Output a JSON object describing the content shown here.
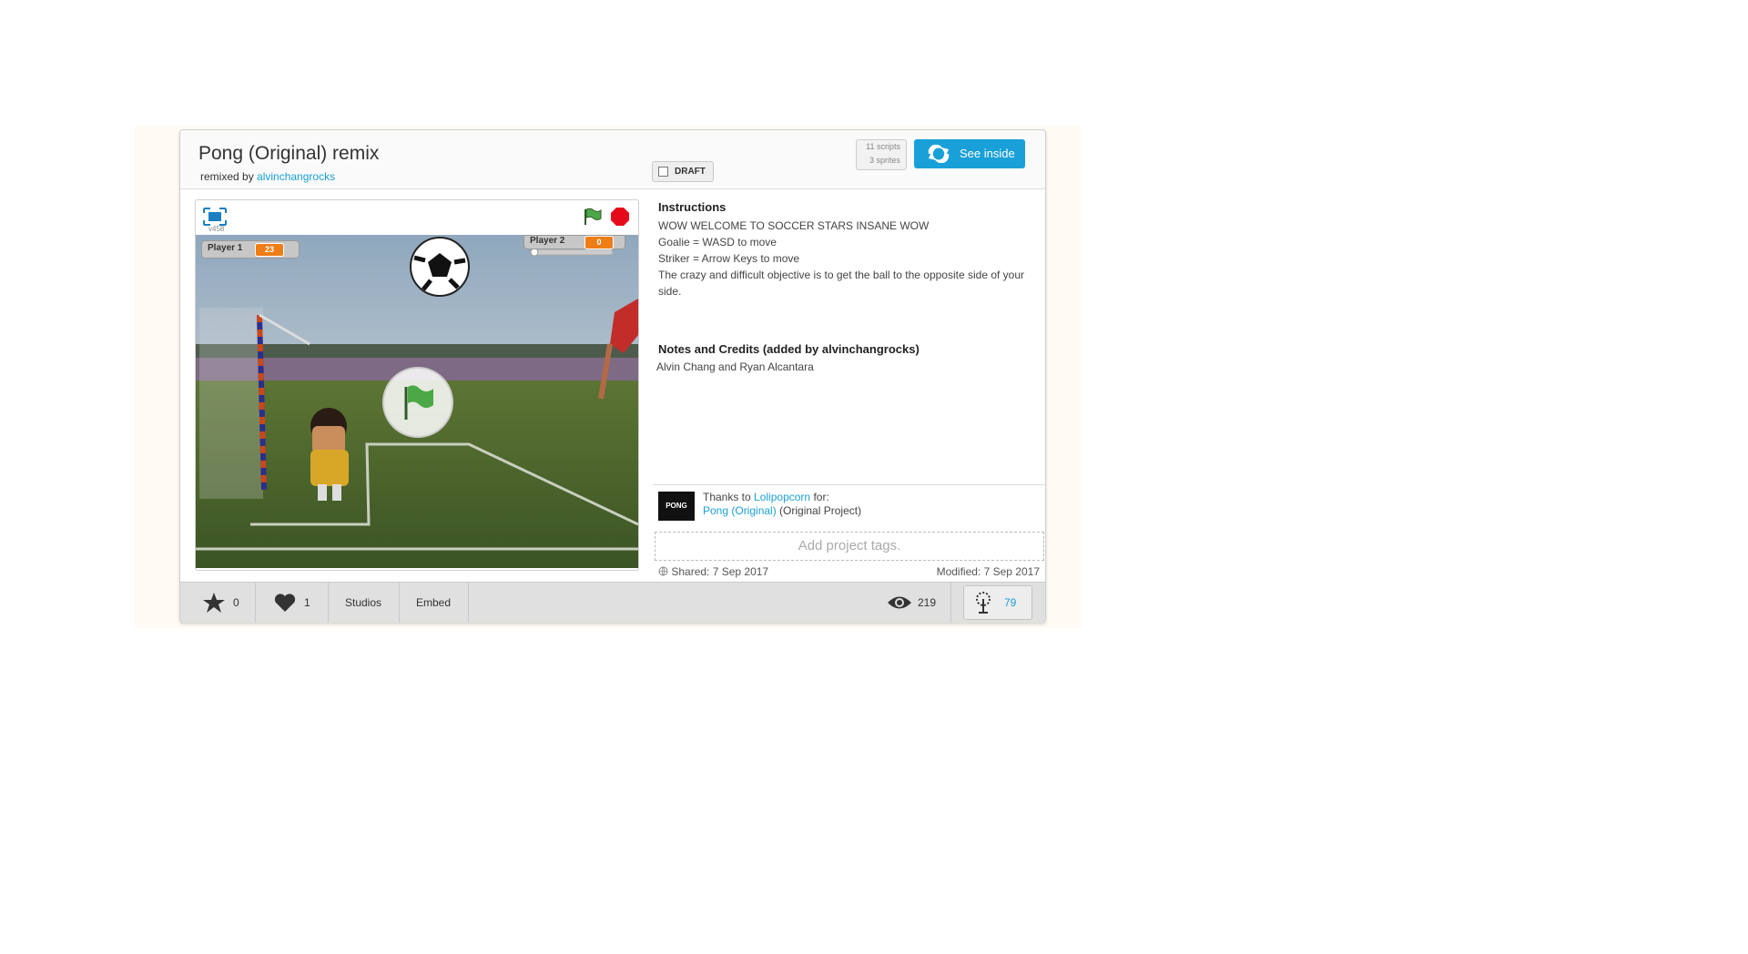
{
  "project": {
    "title": "Pong (Original) remix",
    "remixed_by_prefix": "remixed by",
    "author": "alvinchangrocks",
    "draft_label": "DRAFT",
    "scripts_count": "11 scripts",
    "sprites_count": "3 sprites",
    "see_inside_label": "See inside"
  },
  "player": {
    "version": "v458",
    "monitors": [
      {
        "name": "Player 1",
        "value": "23"
      },
      {
        "name": "Player 2",
        "value": "0"
      }
    ],
    "flag_icon": "green-flag-icon",
    "stop_icon": "stop-icon"
  },
  "info": {
    "instructions_title": "Instructions",
    "instructions_lines": [
      "WOW WELCOME TO SOCCER STARS INSANE WOW",
      "Goalie = WASD to move",
      "Striker = Arrow Keys to move",
      "The crazy and difficult objective is to get the ball to the opposite side of your side."
    ],
    "notes_title": "Notes and Credits (added by alvinchangrocks)",
    "notes_text": "Alvin Chang and Ryan Alcantara",
    "thanks_prefix": "Thanks to",
    "thanks_user": "Lolipopcorn",
    "thanks_for": "for:",
    "original_project_link": "Pong (Original)",
    "original_project_suffix": "(Original Project)",
    "thumb_text": "PONG",
    "tags_placeholder": "Add project tags.",
    "shared": "Shared: 7 Sep 2017",
    "modified": "Modified: 7 Sep 2017"
  },
  "footer": {
    "favorites": "0",
    "loves": "1",
    "studios_label": "Studios",
    "embed_label": "Embed",
    "views": "219",
    "remixes": "79"
  },
  "colors": {
    "accent": "#1aa0d8",
    "monitor_value": "#ee7d16",
    "stop": "#e5091a",
    "flag": "#4ca847"
  }
}
